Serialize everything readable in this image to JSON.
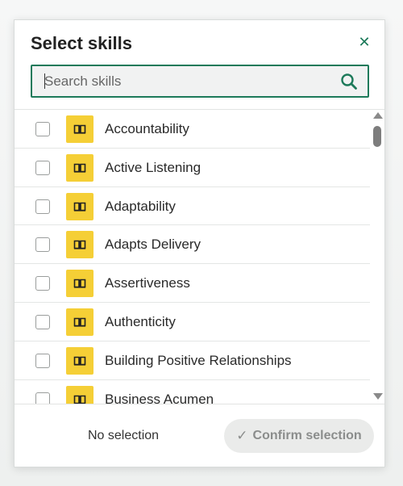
{
  "dialog": {
    "title": "Select skills",
    "close_icon": "close-icon"
  },
  "search": {
    "placeholder": "Search skills",
    "value": "",
    "icon": "search-icon"
  },
  "skills": [
    {
      "label": "Accountability",
      "checked": false,
      "icon": "book-icon"
    },
    {
      "label": "Active Listening",
      "checked": false,
      "icon": "book-icon"
    },
    {
      "label": "Adaptability",
      "checked": false,
      "icon": "book-icon"
    },
    {
      "label": "Adapts Delivery",
      "checked": false,
      "icon": "book-icon"
    },
    {
      "label": "Assertiveness",
      "checked": false,
      "icon": "book-icon"
    },
    {
      "label": "Authenticity",
      "checked": false,
      "icon": "book-icon"
    },
    {
      "label": "Building Positive Relationships",
      "checked": false,
      "icon": "book-icon"
    },
    {
      "label": "Business Acumen",
      "checked": false,
      "icon": "book-icon"
    }
  ],
  "footer": {
    "selection_status": "No selection",
    "confirm_label": "Confirm selection",
    "confirm_icon": "checkmark-icon"
  },
  "colors": {
    "accent": "#1d7a5a",
    "skill_icon_bg": "#f5cf36",
    "button_disabled_bg": "#eaebea"
  }
}
